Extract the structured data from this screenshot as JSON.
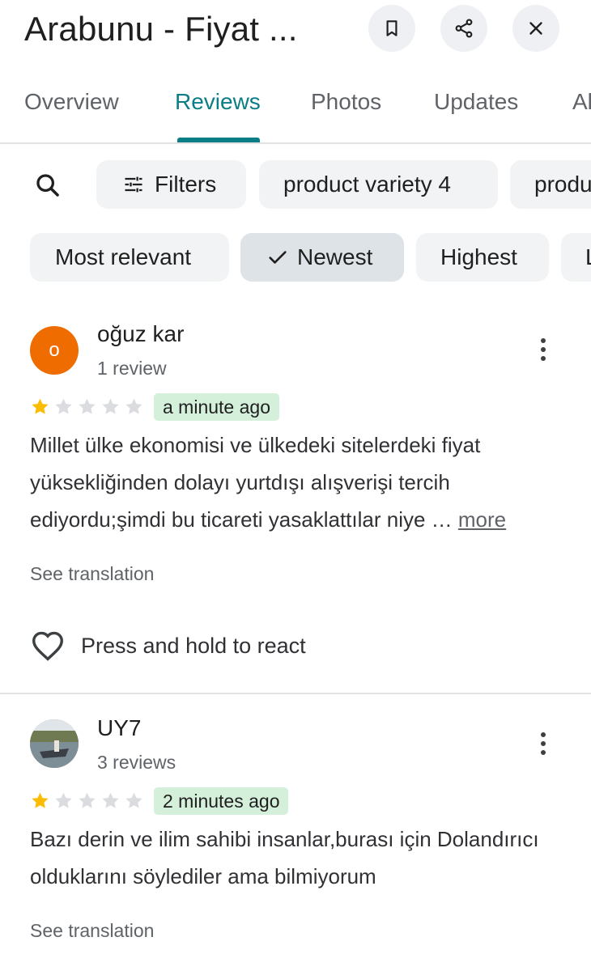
{
  "header": {
    "title": "Arabunu - Fiyat ...",
    "bookmark_icon": "bookmark-icon",
    "share_icon": "share-icon",
    "close_icon": "close-icon"
  },
  "tabs": [
    {
      "label": "Overview",
      "active": false
    },
    {
      "label": "Reviews",
      "active": true
    },
    {
      "label": "Photos",
      "active": false
    },
    {
      "label": "Updates",
      "active": false
    },
    {
      "label": "Al",
      "active": false
    }
  ],
  "filters": {
    "search_icon": "search-icon",
    "filters_label": "Filters",
    "topic_chips": [
      "product variety 4",
      "produ"
    ]
  },
  "sort": {
    "options": [
      {
        "label": "Most relevant",
        "selected": false
      },
      {
        "label": "Newest",
        "selected": true
      },
      {
        "label": "Highest",
        "selected": false
      },
      {
        "label": "L",
        "selected": false
      }
    ]
  },
  "reviews": [
    {
      "avatar_letter": "o",
      "avatar_color": "#ef6c00",
      "name": "oğuz kar",
      "review_count": "1 review",
      "rating": 1,
      "max_rating": 5,
      "time": "a minute ago",
      "text": "Millet ülke ekonomisi ve ülkedeki sitelerdeki fiyat yüksekliğinden dolayı yurtdışı alışverişi  tercih ediyordu;şimdi bu ticareti yasaklattılar niye … ",
      "more_label": "more",
      "see_translation": "See translation",
      "react_label": "Press and hold to react"
    },
    {
      "name": "UY7",
      "review_count": "3 reviews",
      "rating": 1,
      "max_rating": 5,
      "time": "2 minutes ago",
      "text": "Bazı derin ve ilim sahibi insanlar,burası için Dolandırıcı olduklarını söylediler ama bilmiyorum",
      "see_translation": "See translation"
    }
  ],
  "colors": {
    "accent": "#0b7d86",
    "star_filled": "#fbbc04",
    "star_empty": "#dadce0",
    "time_badge": "#d4f0db"
  }
}
